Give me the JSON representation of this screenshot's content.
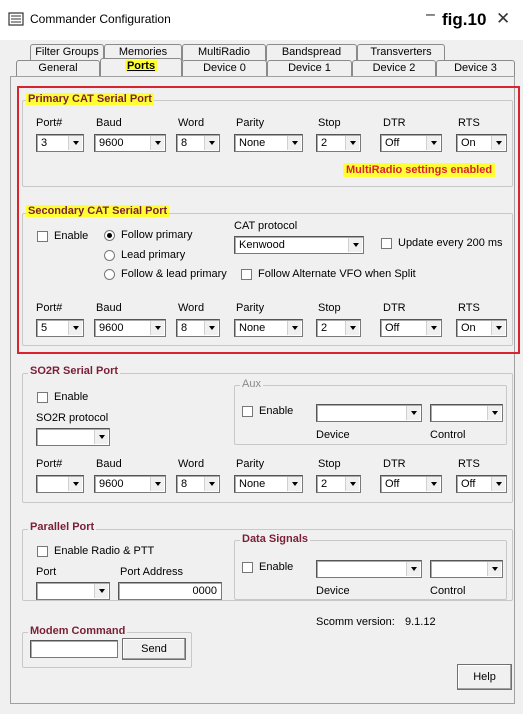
{
  "window": {
    "title": "Commander Configuration",
    "minimize": "–",
    "close": "✕",
    "fig_label": "fig.10"
  },
  "tabs_row1": [
    "Filter Groups",
    "Memories",
    "MultiRadio",
    "Bandspread",
    "Transverters"
  ],
  "tabs_row2": [
    "General",
    "Ports",
    "Device 0",
    "Device 1",
    "Device 2",
    "Device 3"
  ],
  "active_tab": "Ports",
  "col_labels": {
    "port": "Port#",
    "baud": "Baud",
    "word": "Word",
    "parity": "Parity",
    "stop": "Stop",
    "dtr": "DTR",
    "rts": "RTS"
  },
  "primary": {
    "title": "Primary CAT Serial Port",
    "port": "3",
    "baud": "9600",
    "word": "8",
    "parity": "None",
    "stop": "2",
    "dtr": "Off",
    "rts": "On",
    "notice": "MultiRadio settings enabled"
  },
  "secondary": {
    "title": "Secondary CAT Serial Port",
    "enable_label": "Enable",
    "follow_primary": "Follow primary",
    "lead_primary": "Lead primary",
    "follow_lead_primary": "Follow & lead primary",
    "cat_protocol_label": "CAT protocol",
    "cat_protocol": "Kenwood",
    "update_label": "Update every 200 ms",
    "follow_alt_vfo": "Follow Alternate VFO when Split",
    "port": "5",
    "baud": "9600",
    "word": "8",
    "parity": "None",
    "stop": "2",
    "dtr": "Off",
    "rts": "On"
  },
  "so2r": {
    "title": "SO2R Serial Port",
    "enable_label": "Enable",
    "protocol_label": "SO2R protocol",
    "protocol": "",
    "aux_title": "Aux",
    "aux_enable": "Enable",
    "aux_device_label": "Device",
    "aux_control_label": "Control",
    "port": "",
    "baud": "9600",
    "word": "8",
    "parity": "None",
    "stop": "2",
    "dtr": "Off",
    "rts": "Off"
  },
  "parallel": {
    "title": "Parallel Port",
    "enable_label": "Enable Radio & PTT",
    "port_label": "Port",
    "address_label": "Port Address",
    "address": "0000",
    "data_signals_title": "Data Signals",
    "ds_enable": "Enable",
    "ds_device_label": "Device",
    "ds_control_label": "Control"
  },
  "version": {
    "label": "Scomm version:",
    "value": "9.1.12"
  },
  "modem": {
    "title": "Modem Command",
    "input": "",
    "send": "Send"
  },
  "help_button": "Help",
  "colors": {
    "highlight": "#ffff33",
    "red_border": "#d9232f",
    "group_title": "#7a1f35"
  }
}
